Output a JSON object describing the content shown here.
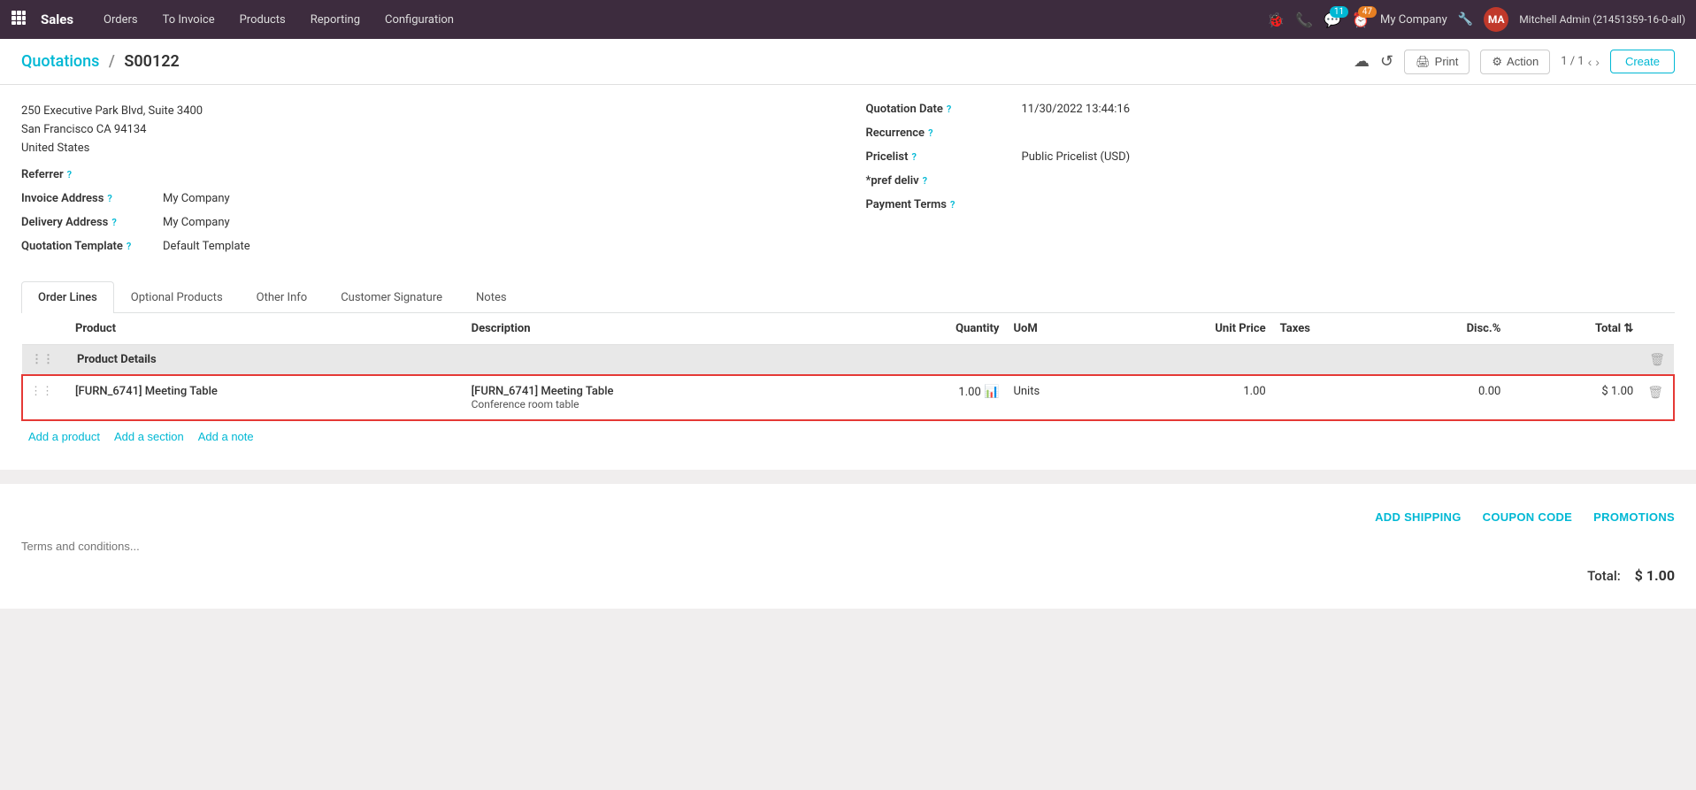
{
  "topnav": {
    "brand": "Sales",
    "items": [
      "Orders",
      "To Invoice",
      "Products",
      "Reporting",
      "Configuration"
    ],
    "badge_chat": "11",
    "badge_clock": "47",
    "company": "My Company",
    "user": "Mitchell Admin (21451359-16-0-all)"
  },
  "header": {
    "breadcrumb_parent": "Quotations",
    "breadcrumb_separator": "/",
    "breadcrumb_current": "S00122",
    "pagination": "1 / 1",
    "btn_print": "Print",
    "btn_action": "Action",
    "btn_create": "Create"
  },
  "form": {
    "address_line1": "250 Executive Park Blvd, Suite 3400",
    "address_line2": "San Francisco CA 94134",
    "address_line3": "United States",
    "referrer_label": "Referrer",
    "invoice_address_label": "Invoice Address",
    "invoice_address_value": "My Company",
    "delivery_address_label": "Delivery Address",
    "delivery_address_value": "My Company",
    "quotation_template_label": "Quotation Template",
    "quotation_template_value": "Default Template",
    "quotation_date_label": "Quotation Date",
    "quotation_date_value": "11/30/2022 13:44:16",
    "recurrence_label": "Recurrence",
    "pricelist_label": "Pricelist",
    "pricelist_value": "Public Pricelist (USD)",
    "pref_deliv_label": "*pref deliv",
    "payment_terms_label": "Payment Terms"
  },
  "tabs": [
    {
      "id": "order-lines",
      "label": "Order Lines",
      "active": true
    },
    {
      "id": "optional-products",
      "label": "Optional Products",
      "active": false
    },
    {
      "id": "other-info",
      "label": "Other Info",
      "active": false
    },
    {
      "id": "customer-signature",
      "label": "Customer Signature",
      "active": false
    },
    {
      "id": "notes",
      "label": "Notes",
      "active": false
    }
  ],
  "table": {
    "columns": [
      "Product",
      "Description",
      "Quantity",
      "UoM",
      "Unit Price",
      "Taxes",
      "Disc.%",
      "Total"
    ],
    "section": {
      "label": "Product Details"
    },
    "rows": [
      {
        "product": "[FURN_6741] Meeting Table",
        "description_line1": "[FURN_6741] Meeting Table",
        "description_line2": "Conference room table",
        "quantity": "1.00",
        "uom": "Units",
        "unit_price": "1.00",
        "taxes": "",
        "disc": "0.00",
        "total": "$ 1.00"
      }
    ],
    "add_product": "Add a product",
    "add_section": "Add a section",
    "add_note": "Add a note"
  },
  "bottom": {
    "add_shipping": "ADD SHIPPING",
    "coupon_code": "COUPON CODE",
    "promotions": "PROMOTIONS",
    "terms_placeholder": "Terms and conditions...",
    "total_label": "Total:",
    "total_value": "$ 1.00"
  }
}
